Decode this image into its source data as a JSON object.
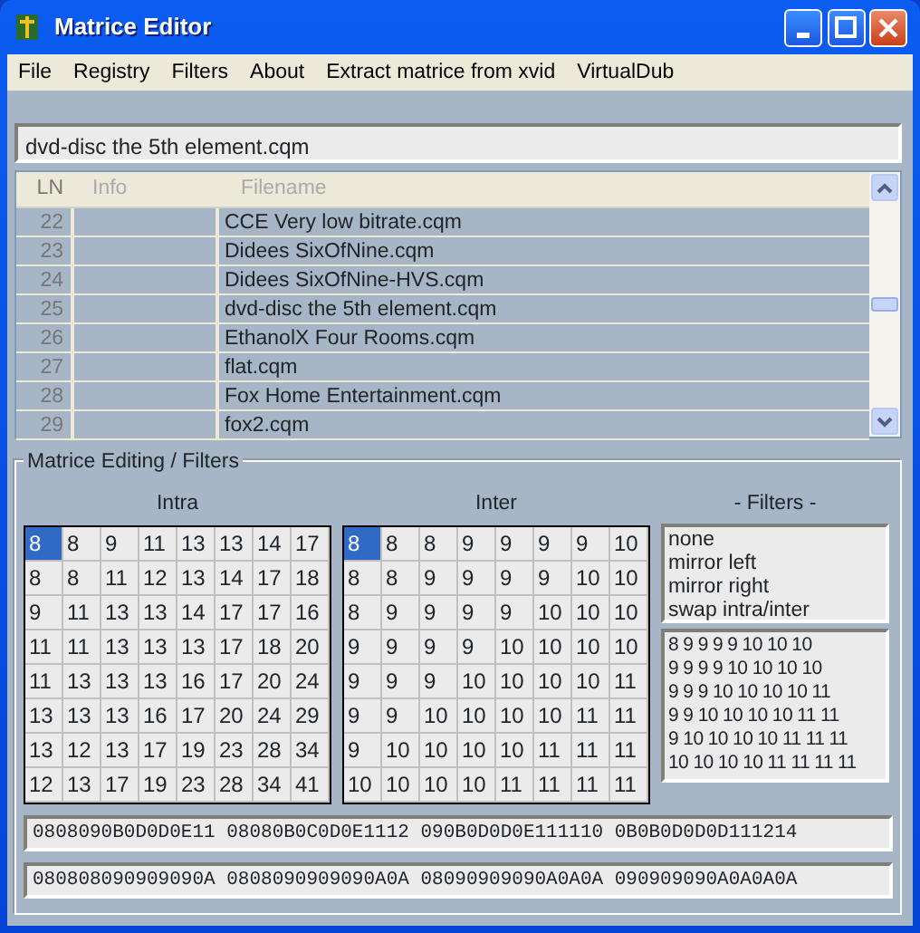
{
  "window": {
    "title": "Matrice Editor"
  },
  "menu": [
    "File",
    "Registry",
    "Filters",
    "About",
    "Extract matrice from xvid",
    "VirtualDub"
  ],
  "current_file": {
    "value": "dvd-disc the 5th element.cqm"
  },
  "file_list": {
    "columns": [
      "LN",
      "Info",
      "Filename"
    ],
    "rows": [
      {
        "ln": "22",
        "filename": "CCE Very low bitrate.cqm"
      },
      {
        "ln": "23",
        "filename": "Didees SixOfNine.cqm"
      },
      {
        "ln": "24",
        "filename": "Didees SixOfNine-HVS.cqm"
      },
      {
        "ln": "25",
        "filename": "dvd-disc the 5th element.cqm"
      },
      {
        "ln": "26",
        "filename": "EthanolX Four Rooms.cqm"
      },
      {
        "ln": "27",
        "filename": "flat.cqm"
      },
      {
        "ln": "28",
        "filename": "Fox Home Entertainment.cqm"
      },
      {
        "ln": "29",
        "filename": "fox2.cqm"
      }
    ]
  },
  "editing": {
    "title": "Matrice Editing / Filters",
    "matrices": [
      {
        "label": "Intra",
        "rows": [
          [
            {
              "v": "8",
              "selected": true
            },
            {
              "v": "8",
              "selected": false
            },
            {
              "v": "9",
              "selected": false
            },
            {
              "v": "11",
              "selected": false
            },
            {
              "v": "13",
              "selected": false
            },
            {
              "v": "13",
              "selected": false
            },
            {
              "v": "14",
              "selected": false
            },
            {
              "v": "17",
              "selected": false
            }
          ],
          [
            {
              "v": "8",
              "selected": false
            },
            {
              "v": "8",
              "selected": false
            },
            {
              "v": "11",
              "selected": false
            },
            {
              "v": "12",
              "selected": false
            },
            {
              "v": "13",
              "selected": false
            },
            {
              "v": "14",
              "selected": false
            },
            {
              "v": "17",
              "selected": false
            },
            {
              "v": "18",
              "selected": false
            }
          ],
          [
            {
              "v": "9",
              "selected": false
            },
            {
              "v": "11",
              "selected": false
            },
            {
              "v": "13",
              "selected": false
            },
            {
              "v": "13",
              "selected": false
            },
            {
              "v": "14",
              "selected": false
            },
            {
              "v": "17",
              "selected": false
            },
            {
              "v": "17",
              "selected": false
            },
            {
              "v": "16",
              "selected": false
            }
          ],
          [
            {
              "v": "11",
              "selected": false
            },
            {
              "v": "11",
              "selected": false
            },
            {
              "v": "13",
              "selected": false
            },
            {
              "v": "13",
              "selected": false
            },
            {
              "v": "13",
              "selected": false
            },
            {
              "v": "17",
              "selected": false
            },
            {
              "v": "18",
              "selected": false
            },
            {
              "v": "20",
              "selected": false
            }
          ],
          [
            {
              "v": "11",
              "selected": false
            },
            {
              "v": "13",
              "selected": false
            },
            {
              "v": "13",
              "selected": false
            },
            {
              "v": "13",
              "selected": false
            },
            {
              "v": "16",
              "selected": false
            },
            {
              "v": "17",
              "selected": false
            },
            {
              "v": "20",
              "selected": false
            },
            {
              "v": "24",
              "selected": false
            }
          ],
          [
            {
              "v": "13",
              "selected": false
            },
            {
              "v": "13",
              "selected": false
            },
            {
              "v": "13",
              "selected": false
            },
            {
              "v": "16",
              "selected": false
            },
            {
              "v": "17",
              "selected": false
            },
            {
              "v": "20",
              "selected": false
            },
            {
              "v": "24",
              "selected": false
            },
            {
              "v": "29",
              "selected": false
            }
          ],
          [
            {
              "v": "13",
              "selected": false
            },
            {
              "v": "12",
              "selected": false
            },
            {
              "v": "13",
              "selected": false
            },
            {
              "v": "17",
              "selected": false
            },
            {
              "v": "19",
              "selected": false
            },
            {
              "v": "23",
              "selected": false
            },
            {
              "v": "28",
              "selected": false
            },
            {
              "v": "34",
              "selected": false
            }
          ],
          [
            {
              "v": "12",
              "selected": false
            },
            {
              "v": "13",
              "selected": false
            },
            {
              "v": "17",
              "selected": false
            },
            {
              "v": "19",
              "selected": false
            },
            {
              "v": "23",
              "selected": false
            },
            {
              "v": "28",
              "selected": false
            },
            {
              "v": "34",
              "selected": false
            },
            {
              "v": "41",
              "selected": false
            }
          ]
        ]
      },
      {
        "label": "Inter",
        "rows": [
          [
            {
              "v": "8",
              "selected": true
            },
            {
              "v": "8",
              "selected": false
            },
            {
              "v": "8",
              "selected": false
            },
            {
              "v": "9",
              "selected": false
            },
            {
              "v": "9",
              "selected": false
            },
            {
              "v": "9",
              "selected": false
            },
            {
              "v": "9",
              "selected": false
            },
            {
              "v": "10",
              "selected": false
            }
          ],
          [
            {
              "v": "8",
              "selected": false
            },
            {
              "v": "8",
              "selected": false
            },
            {
              "v": "9",
              "selected": false
            },
            {
              "v": "9",
              "selected": false
            },
            {
              "v": "9",
              "selected": false
            },
            {
              "v": "9",
              "selected": false
            },
            {
              "v": "10",
              "selected": false
            },
            {
              "v": "10",
              "selected": false
            }
          ],
          [
            {
              "v": "8",
              "selected": false
            },
            {
              "v": "9",
              "selected": false
            },
            {
              "v": "9",
              "selected": false
            },
            {
              "v": "9",
              "selected": false
            },
            {
              "v": "9",
              "selected": false
            },
            {
              "v": "10",
              "selected": false
            },
            {
              "v": "10",
              "selected": false
            },
            {
              "v": "10",
              "selected": false
            }
          ],
          [
            {
              "v": "9",
              "selected": false
            },
            {
              "v": "9",
              "selected": false
            },
            {
              "v": "9",
              "selected": false
            },
            {
              "v": "9",
              "selected": false
            },
            {
              "v": "10",
              "selected": false
            },
            {
              "v": "10",
              "selected": false
            },
            {
              "v": "10",
              "selected": false
            },
            {
              "v": "10",
              "selected": false
            }
          ],
          [
            {
              "v": "9",
              "selected": false
            },
            {
              "v": "9",
              "selected": false
            },
            {
              "v": "9",
              "selected": false
            },
            {
              "v": "10",
              "selected": false
            },
            {
              "v": "10",
              "selected": false
            },
            {
              "v": "10",
              "selected": false
            },
            {
              "v": "10",
              "selected": false
            },
            {
              "v": "11",
              "selected": false
            }
          ],
          [
            {
              "v": "9",
              "selected": false
            },
            {
              "v": "9",
              "selected": false
            },
            {
              "v": "10",
              "selected": false
            },
            {
              "v": "10",
              "selected": false
            },
            {
              "v": "10",
              "selected": false
            },
            {
              "v": "10",
              "selected": false
            },
            {
              "v": "11",
              "selected": false
            },
            {
              "v": "11",
              "selected": false
            }
          ],
          [
            {
              "v": "9",
              "selected": false
            },
            {
              "v": "10",
              "selected": false
            },
            {
              "v": "10",
              "selected": false
            },
            {
              "v": "10",
              "selected": false
            },
            {
              "v": "10",
              "selected": false
            },
            {
              "v": "11",
              "selected": false
            },
            {
              "v": "11",
              "selected": false
            },
            {
              "v": "11",
              "selected": false
            }
          ],
          [
            {
              "v": "10",
              "selected": false
            },
            {
              "v": "10",
              "selected": false
            },
            {
              "v": "10",
              "selected": false
            },
            {
              "v": "10",
              "selected": false
            },
            {
              "v": "11",
              "selected": false
            },
            {
              "v": "11",
              "selected": false
            },
            {
              "v": "11",
              "selected": false
            },
            {
              "v": "11",
              "selected": false
            }
          ]
        ]
      }
    ],
    "filters": {
      "label": "- Filters -",
      "options": [
        {
          "label": "none",
          "selected": false
        },
        {
          "label": "mirror left",
          "selected": false
        },
        {
          "label": "mirror right",
          "selected": false
        },
        {
          "label": "swap intra/inter",
          "selected": false
        }
      ],
      "preview": [
        "8 9 9 9 9 10 10 10",
        "9 9 9 9 10 10 10 10",
        "9 9 9 10 10 10 10 11",
        "9 9 10 10 10 10 11 11",
        "9 10 10 10 10 11 11 11",
        "10 10 10 10 11 11 11 11"
      ]
    }
  },
  "hex_lines": [
    "0808090B0D0D0E11 08080B0C0D0E1112 090B0D0D0E111110 0B0B0D0D0D111214",
    "080808090909090A 0808090909090A0A 08090909090A0A0A 090909090A0A0A0A"
  ]
}
